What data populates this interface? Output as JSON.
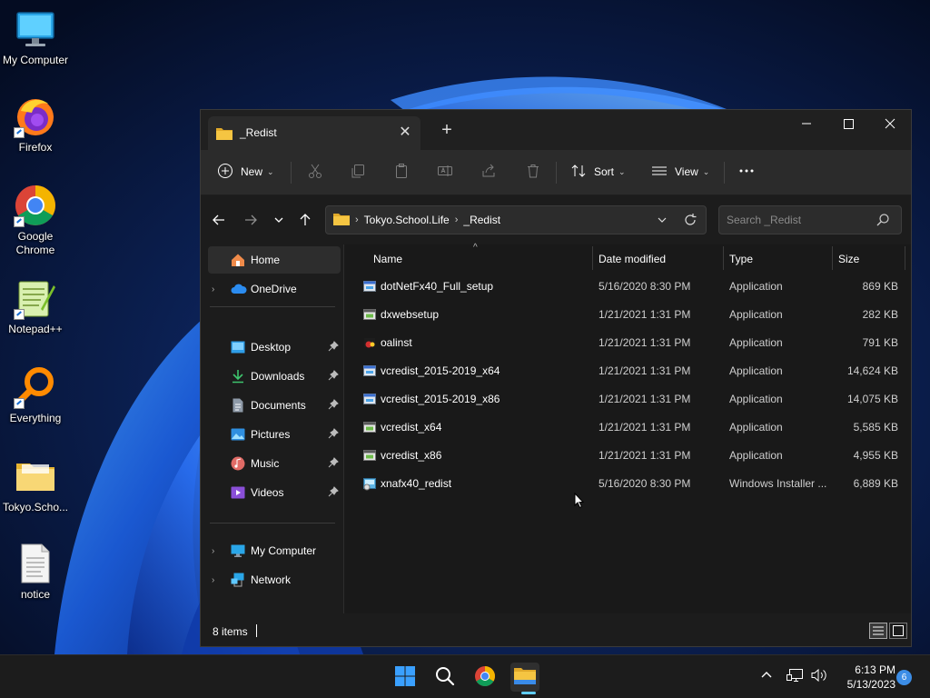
{
  "desktop": {
    "icons": [
      {
        "label": "My Computer",
        "icon": "monitor-icon"
      },
      {
        "label": "Firefox",
        "icon": "firefox-icon"
      },
      {
        "label": "Google Chrome",
        "icon": "chrome-icon"
      },
      {
        "label": "Notepad++",
        "icon": "notepadpp-icon"
      },
      {
        "label": "Everything",
        "icon": "everything-search-icon"
      },
      {
        "label": "Tokyo.Scho...",
        "icon": "folder-icon"
      },
      {
        "label": "notice",
        "icon": "text-document-icon"
      }
    ]
  },
  "window": {
    "tab_title": "_Redist",
    "toolbar": {
      "new_label": "New",
      "sort_label": "Sort",
      "view_label": "View"
    },
    "address": {
      "crumbs": [
        "Tokyo.School.Life",
        "_Redist"
      ]
    },
    "search": {
      "placeholder": "Search _Redist"
    },
    "nav": {
      "home": "Home",
      "onedrive": "OneDrive",
      "quick_access": [
        {
          "label": "Desktop",
          "icon": "desktop-icon"
        },
        {
          "label": "Downloads",
          "icon": "downloads-icon"
        },
        {
          "label": "Documents",
          "icon": "documents-icon"
        },
        {
          "label": "Pictures",
          "icon": "pictures-icon"
        },
        {
          "label": "Music",
          "icon": "music-icon"
        },
        {
          "label": "Videos",
          "icon": "videos-icon"
        }
      ],
      "my_computer": "My Computer",
      "network": "Network"
    },
    "columns": {
      "name": "Name",
      "date": "Date modified",
      "type": "Type",
      "size": "Size"
    },
    "files": [
      {
        "name": "dotNetFx40_Full_setup",
        "date": "5/16/2020 8:30 PM",
        "type": "Application",
        "size": "869 KB",
        "icon": "setup-app-icon"
      },
      {
        "name": "dxwebsetup",
        "date": "1/21/2021 1:31 PM",
        "type": "Application",
        "size": "282 KB",
        "icon": "app-icon"
      },
      {
        "name": "oalinst",
        "date": "1/21/2021 1:31 PM",
        "type": "Application",
        "size": "791 KB",
        "icon": "openal-icon"
      },
      {
        "name": "vcredist_2015-2019_x64",
        "date": "1/21/2021 1:31 PM",
        "type": "Application",
        "size": "14,624 KB",
        "icon": "setup-app-icon"
      },
      {
        "name": "vcredist_2015-2019_x86",
        "date": "1/21/2021 1:31 PM",
        "type": "Application",
        "size": "14,075 KB",
        "icon": "setup-app-icon"
      },
      {
        "name": "vcredist_x64",
        "date": "1/21/2021 1:31 PM",
        "type": "Application",
        "size": "5,585 KB",
        "icon": "app-icon"
      },
      {
        "name": "vcredist_x86",
        "date": "1/21/2021 1:31 PM",
        "type": "Application",
        "size": "4,955 KB",
        "icon": "app-icon"
      },
      {
        "name": "xnafx40_redist",
        "date": "5/16/2020 8:30 PM",
        "type": "Windows Installer ...",
        "size": "6,889 KB",
        "icon": "msi-installer-icon"
      }
    ],
    "status": {
      "item_count": "8 items"
    }
  },
  "taskbar": {
    "clock_time": "6:13 PM",
    "clock_date": "5/13/2023",
    "notification_count": "6"
  },
  "colors": {
    "accent": "#60cdff",
    "folder": "#f5c542",
    "window_bg": "#191919"
  }
}
